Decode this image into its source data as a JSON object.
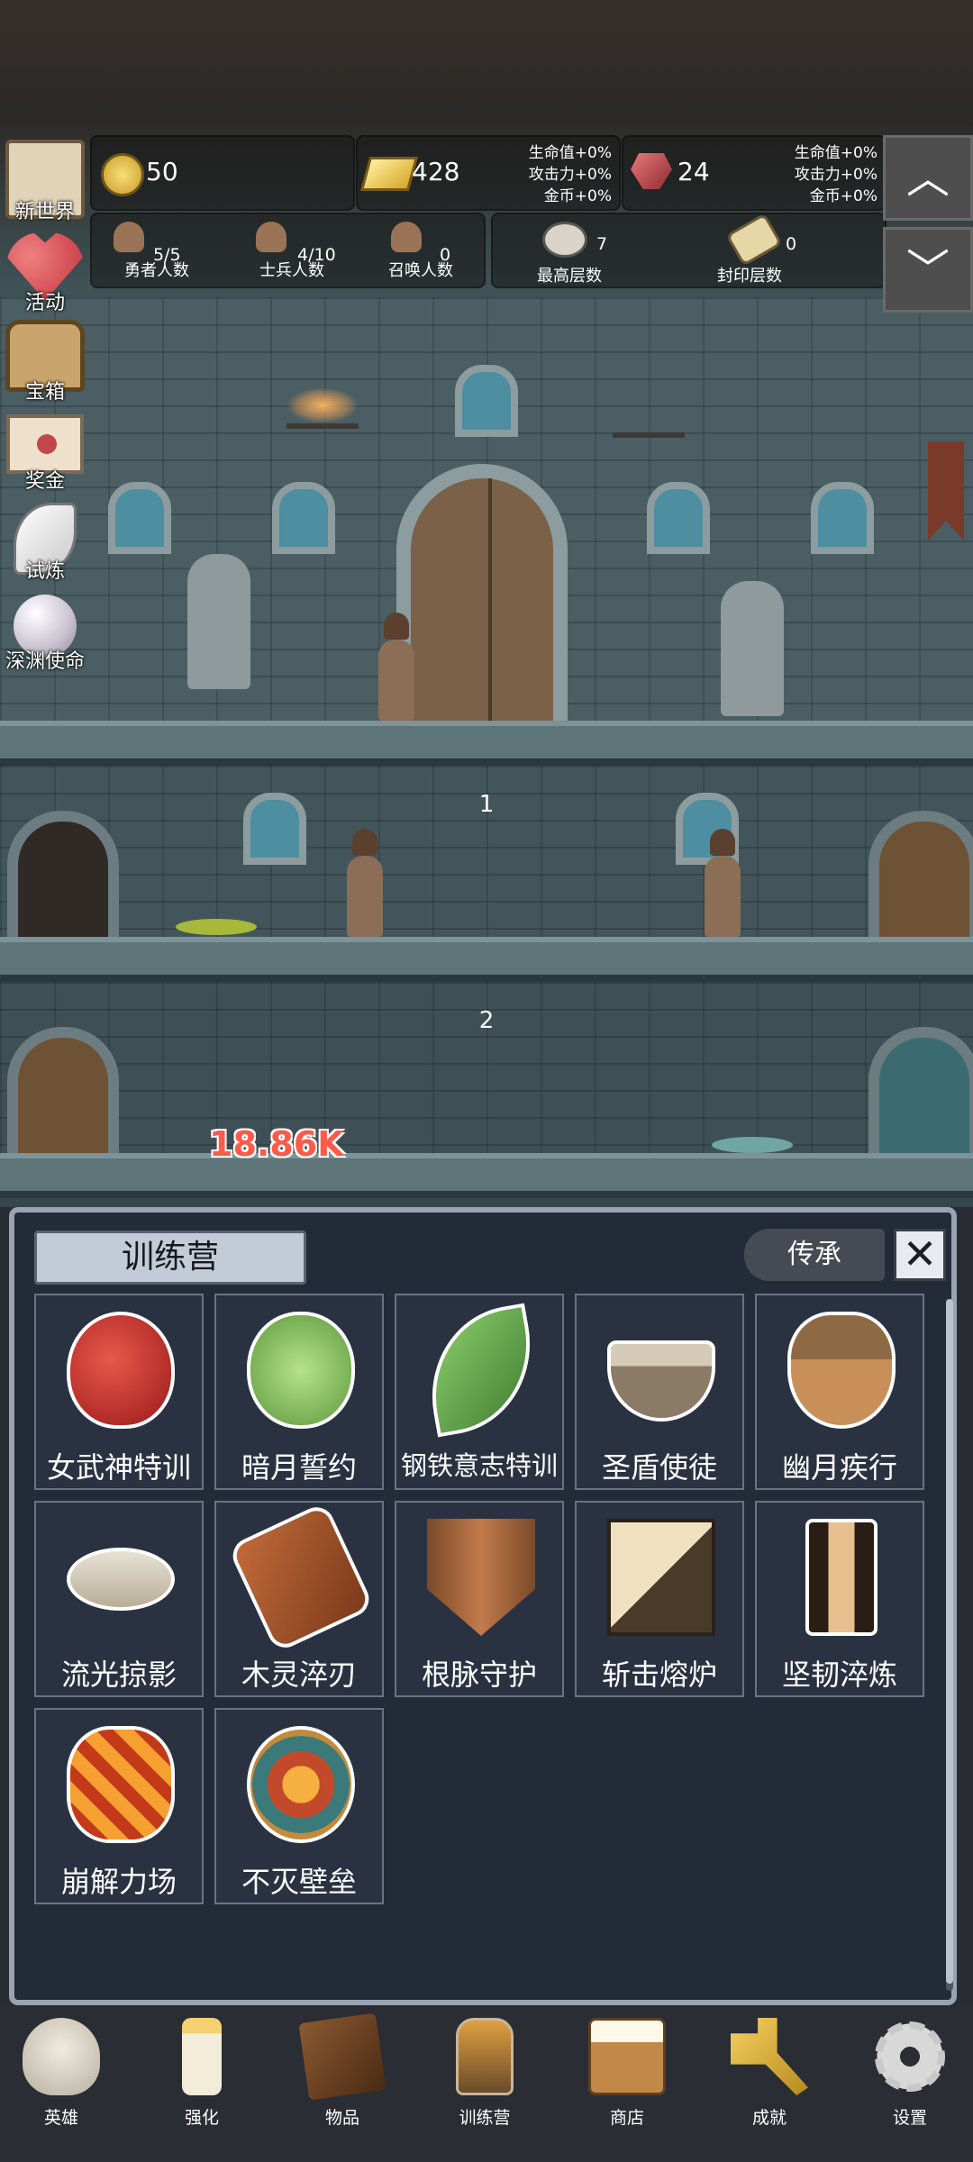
{
  "resources": {
    "gold": "50",
    "gold_bars": "428",
    "gems": "24",
    "bonus_a": [
      "生命值+0%",
      "攻击力+0%",
      "金币+0%"
    ],
    "bonus_b": [
      "生命值+0%",
      "攻击力+0%",
      "金币+0%"
    ]
  },
  "counts": {
    "heroes": {
      "value": "5/5",
      "label": "勇者人数"
    },
    "soldiers": {
      "value": "4/10",
      "label": "士兵人数"
    },
    "summons": {
      "value": "0",
      "label": "召唤人数"
    },
    "max_floor": {
      "value": "7",
      "label": "最高层数"
    },
    "sealed_floor": {
      "value": "0",
      "label": "封印层数"
    }
  },
  "side_menu": [
    {
      "label": "新世界",
      "icon": "map-icon"
    },
    {
      "label": "活动",
      "icon": "heart-icon"
    },
    {
      "label": "宝箱",
      "icon": "chest-icon"
    },
    {
      "label": "奖金",
      "icon": "envelope-icon"
    },
    {
      "label": "试炼",
      "icon": "feather-icon"
    },
    {
      "label": "深渊使命",
      "icon": "pearl-icon"
    }
  ],
  "floors": [
    "1",
    "2"
  ],
  "damage_popup": "18.86K",
  "training": {
    "title": "训练营",
    "inherit_label": "传承",
    "close_label": "✕",
    "items": [
      {
        "name": "女武神特训",
        "icon": "apple-icon"
      },
      {
        "name": "暗月誓约",
        "icon": "cabbage-icon"
      },
      {
        "name": "钢铁意志特训",
        "icon": "leaf-icon"
      },
      {
        "name": "圣盾使徒",
        "icon": "bowl-icon"
      },
      {
        "name": "幽月疾行",
        "icon": "acorn-icon"
      },
      {
        "name": "流光掠影",
        "icon": "fish-fossil-icon"
      },
      {
        "name": "木灵淬刃",
        "icon": "log-icon"
      },
      {
        "name": "根脉守护",
        "icon": "wooden-shield-icon"
      },
      {
        "name": "斩击熔炉",
        "icon": "cube-icon"
      },
      {
        "name": "坚韧淬炼",
        "icon": "plank-icon"
      },
      {
        "name": "崩解力场",
        "icon": "lava-stone-icon"
      },
      {
        "name": "不灭壁垒",
        "icon": "rune-stone-icon"
      }
    ]
  },
  "nav": [
    {
      "label": "英雄",
      "icon": "skull-icon"
    },
    {
      "label": "强化",
      "icon": "candle-icon"
    },
    {
      "label": "物品",
      "icon": "book-icon"
    },
    {
      "label": "训练营",
      "icon": "lantern-icon"
    },
    {
      "label": "商店",
      "icon": "mug-icon"
    },
    {
      "label": "成就",
      "icon": "key-icon"
    },
    {
      "label": "设置",
      "icon": "gear-icon"
    }
  ],
  "arrows": {
    "up": "︿",
    "down": "﹀"
  }
}
